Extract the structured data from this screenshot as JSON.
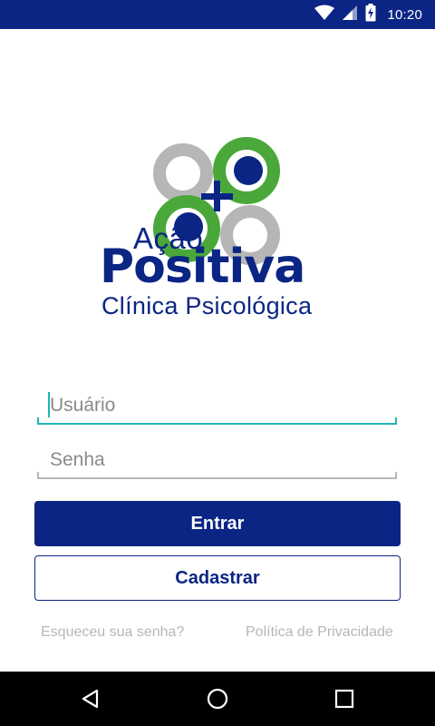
{
  "status_bar": {
    "time": "10:20",
    "icons": [
      "wifi-icon",
      "signal-icon",
      "battery-charging-icon"
    ],
    "color": "#0b2584"
  },
  "logo": {
    "line1": "Ação",
    "line2": "Positiva",
    "line3": "Clínica Psicológica",
    "colors": {
      "navy": "#0b2584",
      "green": "#4aa83b",
      "gray": "#b6b6b6"
    }
  },
  "form": {
    "username": {
      "placeholder": "Usuário",
      "value": ""
    },
    "password": {
      "placeholder": "Senha",
      "value": ""
    },
    "accent": "#20b5b5"
  },
  "buttons": {
    "login": "Entrar",
    "register": "Cadastrar"
  },
  "links": {
    "forgot_password": "Esqueceu sua senha?",
    "privacy_policy": "Política de Privacidade"
  },
  "nav_bar": {
    "buttons": [
      "back-icon",
      "home-icon",
      "recents-icon"
    ]
  }
}
